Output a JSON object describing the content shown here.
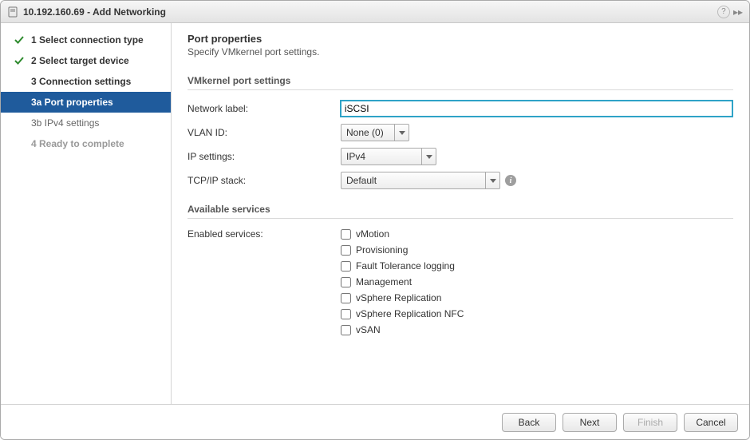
{
  "titlebar": {
    "title": "10.192.160.69 - Add Networking"
  },
  "sidebar": {
    "steps": {
      "s1": "1  Select connection type",
      "s2": "2  Select target device",
      "s3": "3  Connection settings",
      "s3a": "3a  Port properties",
      "s3b": "3b  IPv4 settings",
      "s4": "4  Ready to complete"
    }
  },
  "main": {
    "heading": "Port properties",
    "subtitle": "Specify VMkernel port settings.",
    "section_vmkernel": "VMkernel port settings",
    "labels": {
      "network_label": "Network label:",
      "vlan_id": "VLAN ID:",
      "ip_settings": "IP settings:",
      "tcpip_stack": "TCP/IP stack:"
    },
    "values": {
      "network_label": "iSCSI",
      "vlan_id": "None (0)",
      "ip_settings": "IPv4",
      "tcpip_stack": "Default"
    },
    "section_services": "Available services",
    "labels_services": "Enabled services:",
    "services": [
      "vMotion",
      "Provisioning",
      "Fault Tolerance logging",
      "Management",
      "vSphere Replication",
      "vSphere Replication NFC",
      "vSAN"
    ]
  },
  "footer": {
    "back": "Back",
    "next": "Next",
    "finish": "Finish",
    "cancel": "Cancel"
  }
}
